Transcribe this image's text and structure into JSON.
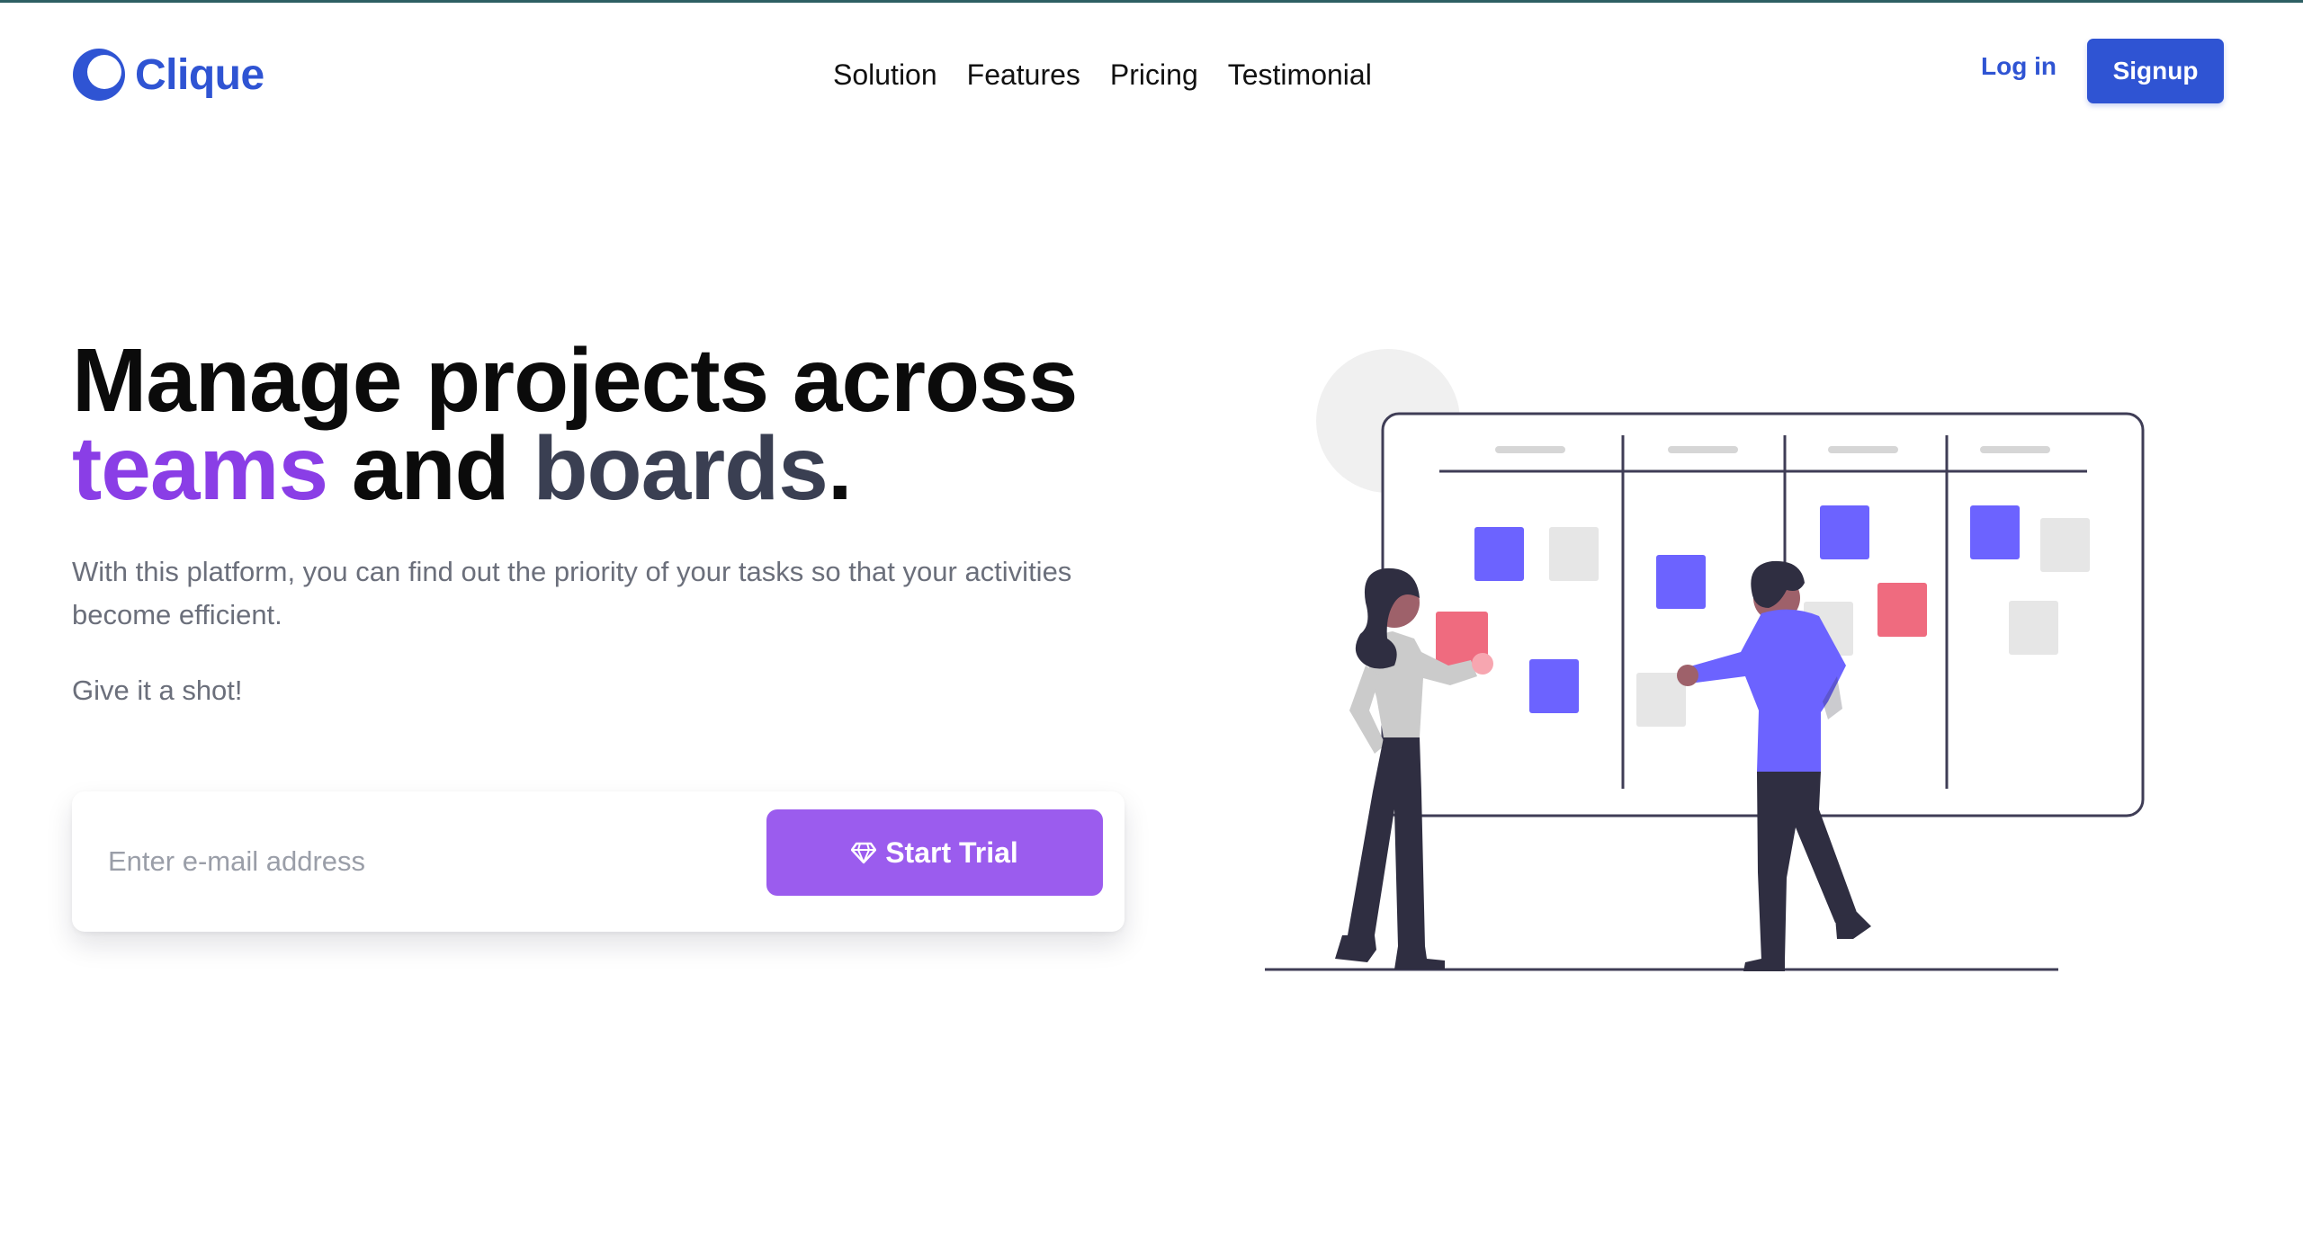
{
  "brand": {
    "name": "Clique",
    "logo_icon": "crescent-logo-icon",
    "color": "#2f54d3"
  },
  "nav": {
    "items": [
      "Solution",
      "Features",
      "Pricing",
      "Testimonial"
    ]
  },
  "auth": {
    "login_label": "Log in",
    "signup_label": "Signup"
  },
  "hero": {
    "headline_line1": "Manage projects across",
    "headline_word_teams": "teams",
    "headline_word_and": "and",
    "headline_word_boards": "boards",
    "headline_period": ".",
    "description": "With this platform, you can find out the priority of your tasks so that your activities become efficient.",
    "cta_text": "Give it a shot!"
  },
  "signup_form": {
    "email_placeholder": "Enter e-mail address",
    "button_label": "Start Trial",
    "button_icon": "diamond-icon"
  },
  "colors": {
    "accent_purple": "#9b5cee",
    "teams_color": "#8a3ee6",
    "boards_color": "#3a3f52",
    "card_purple": "#6c63ff",
    "card_pink": "#ef6b7f",
    "card_gray": "#e6e6e6"
  }
}
